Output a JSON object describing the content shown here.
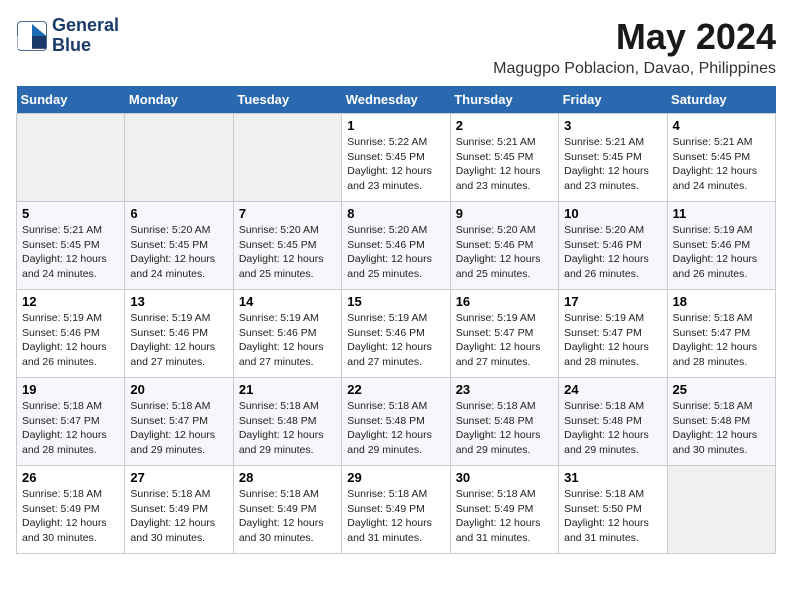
{
  "logo": {
    "line1": "General",
    "line2": "Blue"
  },
  "title": "May 2024",
  "location": "Magugpo Poblacion, Davao, Philippines",
  "weekdays": [
    "Sunday",
    "Monday",
    "Tuesday",
    "Wednesday",
    "Thursday",
    "Friday",
    "Saturday"
  ],
  "days": [
    {
      "num": null,
      "info": null
    },
    {
      "num": null,
      "info": null
    },
    {
      "num": null,
      "info": null
    },
    {
      "num": "1",
      "info": "Sunrise: 5:22 AM\nSunset: 5:45 PM\nDaylight: 12 hours\nand 23 minutes."
    },
    {
      "num": "2",
      "info": "Sunrise: 5:21 AM\nSunset: 5:45 PM\nDaylight: 12 hours\nand 23 minutes."
    },
    {
      "num": "3",
      "info": "Sunrise: 5:21 AM\nSunset: 5:45 PM\nDaylight: 12 hours\nand 23 minutes."
    },
    {
      "num": "4",
      "info": "Sunrise: 5:21 AM\nSunset: 5:45 PM\nDaylight: 12 hours\nand 24 minutes."
    },
    {
      "num": "5",
      "info": "Sunrise: 5:21 AM\nSunset: 5:45 PM\nDaylight: 12 hours\nand 24 minutes."
    },
    {
      "num": "6",
      "info": "Sunrise: 5:20 AM\nSunset: 5:45 PM\nDaylight: 12 hours\nand 24 minutes."
    },
    {
      "num": "7",
      "info": "Sunrise: 5:20 AM\nSunset: 5:45 PM\nDaylight: 12 hours\nand 25 minutes."
    },
    {
      "num": "8",
      "info": "Sunrise: 5:20 AM\nSunset: 5:46 PM\nDaylight: 12 hours\nand 25 minutes."
    },
    {
      "num": "9",
      "info": "Sunrise: 5:20 AM\nSunset: 5:46 PM\nDaylight: 12 hours\nand 25 minutes."
    },
    {
      "num": "10",
      "info": "Sunrise: 5:20 AM\nSunset: 5:46 PM\nDaylight: 12 hours\nand 26 minutes."
    },
    {
      "num": "11",
      "info": "Sunrise: 5:19 AM\nSunset: 5:46 PM\nDaylight: 12 hours\nand 26 minutes."
    },
    {
      "num": "12",
      "info": "Sunrise: 5:19 AM\nSunset: 5:46 PM\nDaylight: 12 hours\nand 26 minutes."
    },
    {
      "num": "13",
      "info": "Sunrise: 5:19 AM\nSunset: 5:46 PM\nDaylight: 12 hours\nand 27 minutes."
    },
    {
      "num": "14",
      "info": "Sunrise: 5:19 AM\nSunset: 5:46 PM\nDaylight: 12 hours\nand 27 minutes."
    },
    {
      "num": "15",
      "info": "Sunrise: 5:19 AM\nSunset: 5:46 PM\nDaylight: 12 hours\nand 27 minutes."
    },
    {
      "num": "16",
      "info": "Sunrise: 5:19 AM\nSunset: 5:47 PM\nDaylight: 12 hours\nand 27 minutes."
    },
    {
      "num": "17",
      "info": "Sunrise: 5:19 AM\nSunset: 5:47 PM\nDaylight: 12 hours\nand 28 minutes."
    },
    {
      "num": "18",
      "info": "Sunrise: 5:18 AM\nSunset: 5:47 PM\nDaylight: 12 hours\nand 28 minutes."
    },
    {
      "num": "19",
      "info": "Sunrise: 5:18 AM\nSunset: 5:47 PM\nDaylight: 12 hours\nand 28 minutes."
    },
    {
      "num": "20",
      "info": "Sunrise: 5:18 AM\nSunset: 5:47 PM\nDaylight: 12 hours\nand 29 minutes."
    },
    {
      "num": "21",
      "info": "Sunrise: 5:18 AM\nSunset: 5:48 PM\nDaylight: 12 hours\nand 29 minutes."
    },
    {
      "num": "22",
      "info": "Sunrise: 5:18 AM\nSunset: 5:48 PM\nDaylight: 12 hours\nand 29 minutes."
    },
    {
      "num": "23",
      "info": "Sunrise: 5:18 AM\nSunset: 5:48 PM\nDaylight: 12 hours\nand 29 minutes."
    },
    {
      "num": "24",
      "info": "Sunrise: 5:18 AM\nSunset: 5:48 PM\nDaylight: 12 hours\nand 29 minutes."
    },
    {
      "num": "25",
      "info": "Sunrise: 5:18 AM\nSunset: 5:48 PM\nDaylight: 12 hours\nand 30 minutes."
    },
    {
      "num": "26",
      "info": "Sunrise: 5:18 AM\nSunset: 5:49 PM\nDaylight: 12 hours\nand 30 minutes."
    },
    {
      "num": "27",
      "info": "Sunrise: 5:18 AM\nSunset: 5:49 PM\nDaylight: 12 hours\nand 30 minutes."
    },
    {
      "num": "28",
      "info": "Sunrise: 5:18 AM\nSunset: 5:49 PM\nDaylight: 12 hours\nand 30 minutes."
    },
    {
      "num": "29",
      "info": "Sunrise: 5:18 AM\nSunset: 5:49 PM\nDaylight: 12 hours\nand 31 minutes."
    },
    {
      "num": "30",
      "info": "Sunrise: 5:18 AM\nSunset: 5:49 PM\nDaylight: 12 hours\nand 31 minutes."
    },
    {
      "num": "31",
      "info": "Sunrise: 5:18 AM\nSunset: 5:50 PM\nDaylight: 12 hours\nand 31 minutes."
    },
    {
      "num": null,
      "info": null
    }
  ]
}
